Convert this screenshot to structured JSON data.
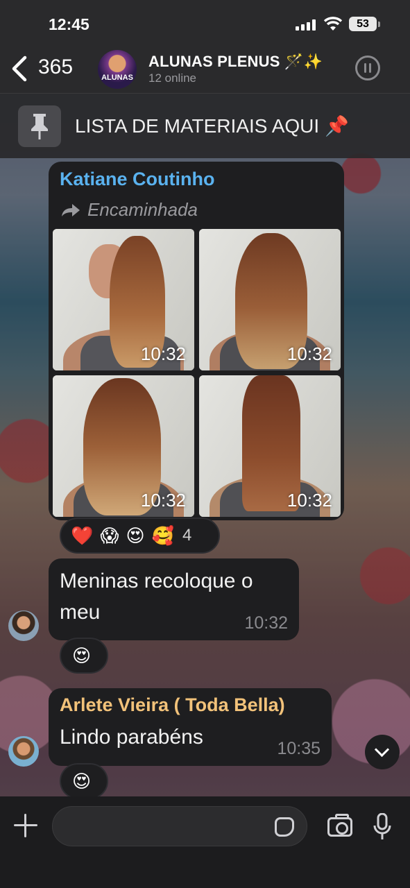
{
  "status_bar": {
    "time": "12:45",
    "battery": "53"
  },
  "header": {
    "back_count": "365",
    "group_avatar_label": "ALUNAS",
    "group_name": "ALUNAS PLENUS 🪄✨",
    "online": "12 online"
  },
  "pinned": {
    "text": "LISTA DE MATERIAIS AQUI 📌"
  },
  "messages": [
    {
      "sender": "Katiane Coutinho",
      "sender_color": "#5ab2ef",
      "forwarded_label": "Encaminhada",
      "photos": [
        {
          "time": "10:32"
        },
        {
          "time": "10:32"
        },
        {
          "time": "10:32"
        },
        {
          "time": "10:32"
        }
      ],
      "reactions": [
        "❤️",
        "😱",
        "😍",
        "🥰"
      ],
      "reaction_count": "4"
    },
    {
      "text": "Meninas recoloque o meu",
      "time": "10:32",
      "reactions": [
        "😍"
      ]
    },
    {
      "sender": "Arlete Vieira ( Toda Bella)",
      "sender_color": "#f2c27a",
      "text": "Lindo parabéns",
      "time": "10:35",
      "reactions": [
        "😍"
      ]
    }
  ],
  "composer": {
    "placeholder": ""
  }
}
